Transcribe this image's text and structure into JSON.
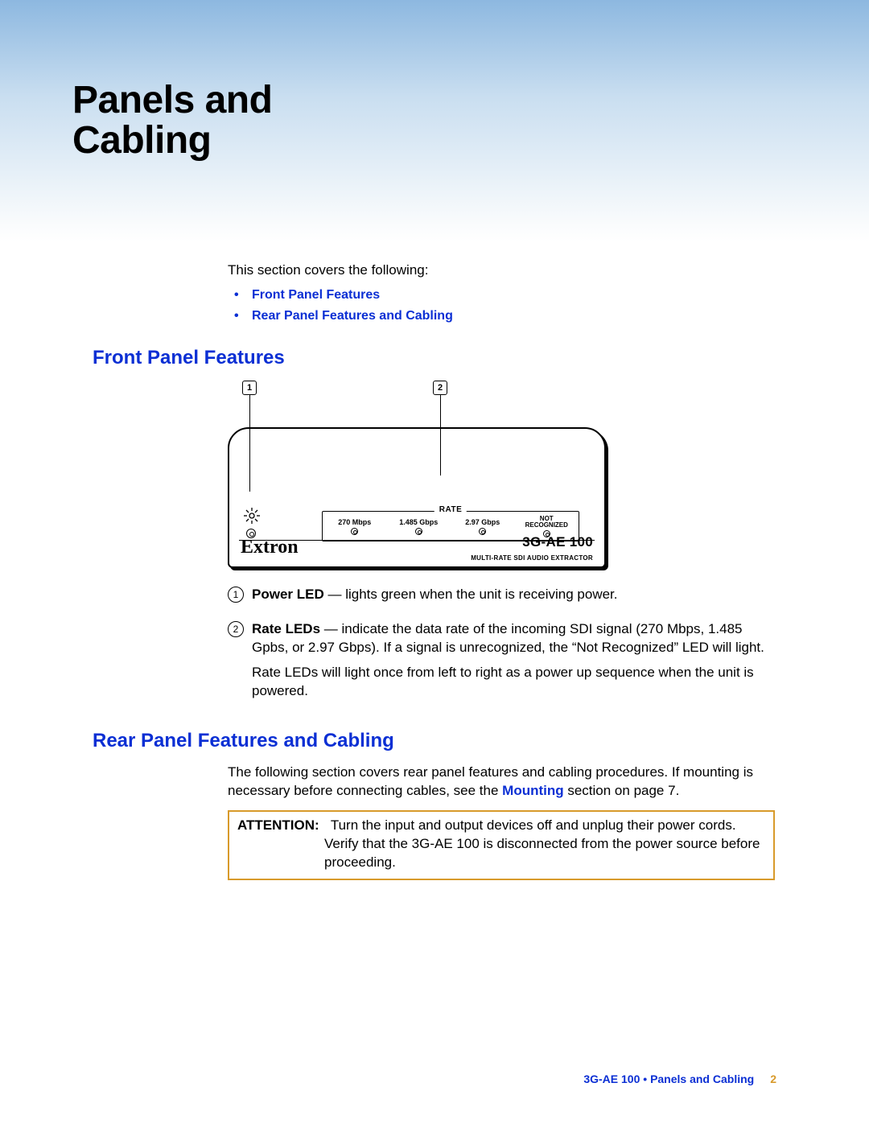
{
  "title_line1": "Panels and",
  "title_line2": "Cabling",
  "intro_lead": "This section covers the following:",
  "toc": [
    "Front Panel Features",
    "Rear Panel Features and Cabling"
  ],
  "section1_heading": "Front Panel Features",
  "diagram": {
    "callout1": "1",
    "callout2": "2",
    "rate_label": "RATE",
    "rates": [
      "270 Mbps",
      "1.485 Gbps",
      "2.97 Gbps"
    ],
    "not_recognized_top": "NOT",
    "not_recognized_bottom": "RECOGNIZED",
    "brand": "Extron",
    "model": "3G-AE 100",
    "subtitle": "MULTI-RATE SDI AUDIO EXTRACTOR"
  },
  "features": [
    {
      "num": "1",
      "label": "Power LED",
      "desc_tail": " — lights green when the unit is receiving power."
    },
    {
      "num": "2",
      "label": "Rate LEDs",
      "desc_tail": " — indicate the data rate of the incoming SDI signal (270 Mbps, 1.485 Gpbs, or 2.97 Gbps). If a signal is unrecognized, the “Not Recognized” LED will light.",
      "extra": "Rate LEDs will light once from left to right as a power up sequence when the unit is powered."
    }
  ],
  "section2_heading": "Rear Panel Features and Cabling",
  "rear_intro_pre": "The following section covers rear panel features and cabling procedures. If mounting is necessary before connecting cables, see the ",
  "rear_intro_link": "Mounting",
  "rear_intro_post": " section on page 7.",
  "attention_label": "ATTENTION:",
  "attention_line1": "Turn the input and output devices off and unplug their power cords.",
  "attention_line2": "Verify that the 3G-AE 100 is disconnected from the power source before proceeding.",
  "footer_product": "3G-AE 100",
  "footer_bullet": " • ",
  "footer_section": "Panels and Cabling",
  "footer_page": "2"
}
